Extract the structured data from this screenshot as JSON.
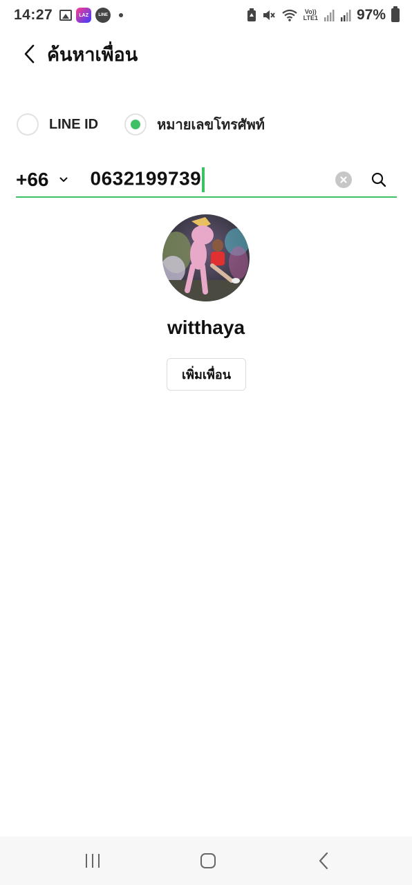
{
  "status_bar": {
    "time": "14:27",
    "notification_icons": [
      "gallery-icon",
      "lazada-icon",
      "line-icon",
      "more-dot-icon"
    ],
    "laz_label": "LAZ",
    "line_label": "LINE",
    "volte_line1": "Vo))",
    "volte_line2": "LTE1",
    "battery_percent": "97%"
  },
  "header": {
    "title": "ค้นหาเพื่อน"
  },
  "search_mode": {
    "options": [
      {
        "label": "LINE ID",
        "checked": false
      },
      {
        "label": "หมายเลขโทรศัพท์",
        "checked": true
      }
    ]
  },
  "phone_search": {
    "country_code": "+66",
    "value": "0632199739"
  },
  "result": {
    "name": "witthaya",
    "add_friend_label": "เพิ่มเพื่อน"
  },
  "colors": {
    "accent": "#3ec164",
    "divider": "#e2e2e2",
    "nav_bg": "#f7f7f7"
  }
}
